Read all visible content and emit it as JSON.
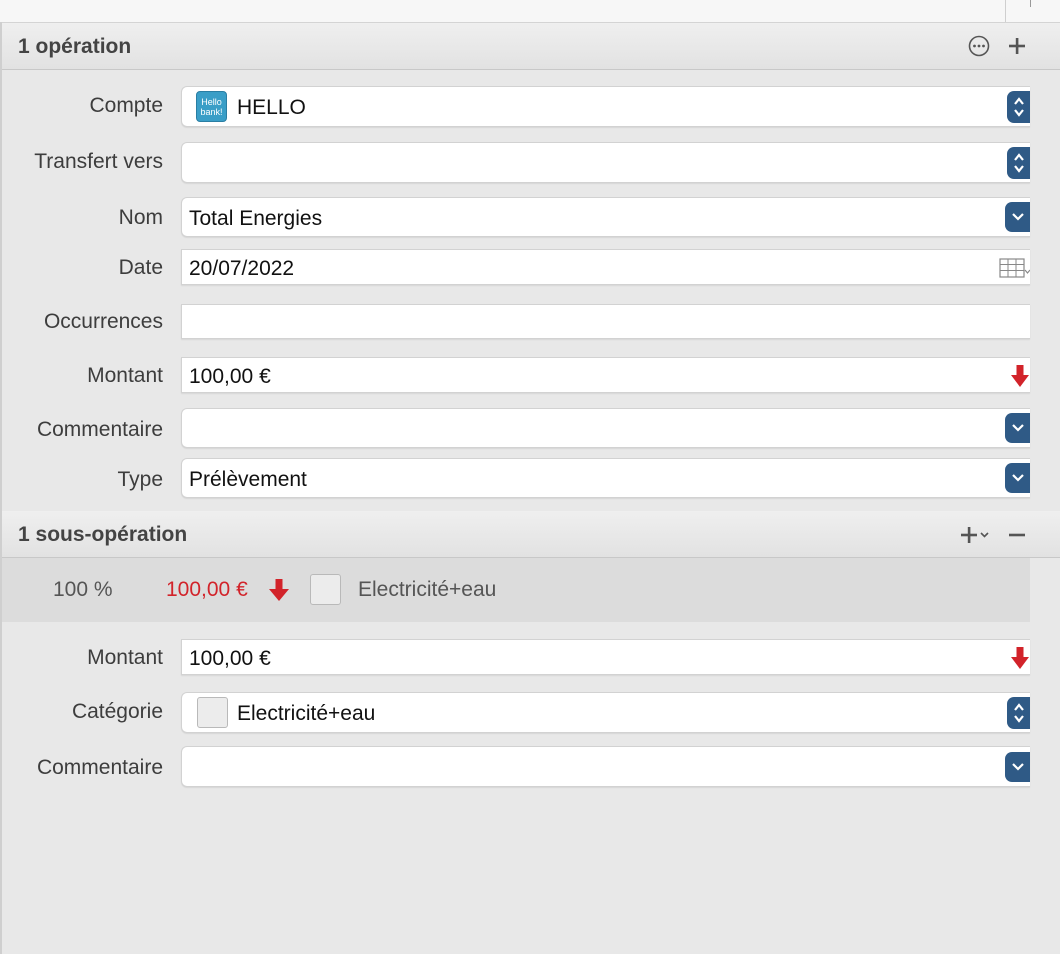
{
  "operation": {
    "header": "1 opération",
    "fields": {
      "compte": {
        "label": "Compte",
        "value": "HELLO",
        "bank_icon_text": "Hello bank!"
      },
      "transfert": {
        "label": "Transfert vers",
        "value": ""
      },
      "nom": {
        "label": "Nom",
        "value": "Total Energies"
      },
      "date": {
        "label": "Date",
        "value": "20/07/2022"
      },
      "occurrences": {
        "label": "Occurrences",
        "value": ""
      },
      "montant": {
        "label": "Montant",
        "value": "100,00 €"
      },
      "commentaire": {
        "label": "Commentaire",
        "value": ""
      },
      "type": {
        "label": "Type",
        "value": "Prélèvement"
      }
    }
  },
  "sub_operation": {
    "header": "1 sous-opération",
    "row": {
      "percent": "100 %",
      "amount": "100,00 €",
      "category": "Electricité+eau"
    },
    "fields": {
      "montant": {
        "label": "Montant",
        "value": "100,00 €"
      },
      "categorie": {
        "label": "Catégorie",
        "value": "Electricité+eau"
      },
      "commentaire": {
        "label": "Commentaire",
        "value": ""
      }
    }
  },
  "colors": {
    "accent_button": "#2f5a86",
    "debit_red": "#d2232a"
  }
}
